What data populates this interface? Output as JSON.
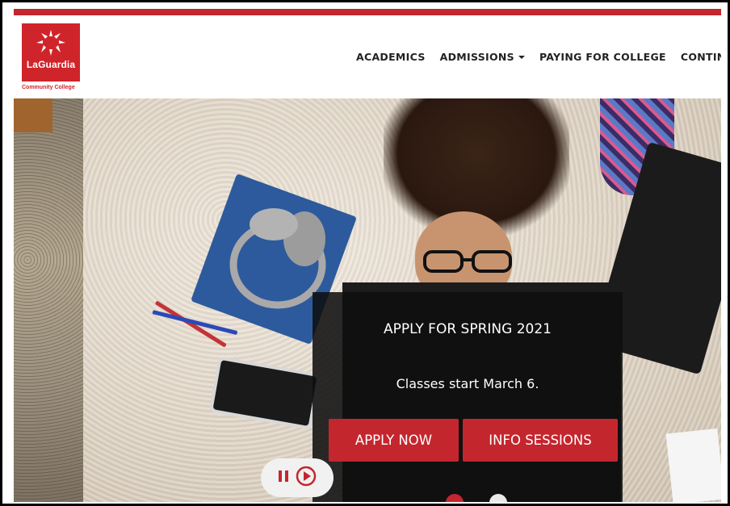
{
  "brand": {
    "name": "LaGuardia",
    "subtitle": "Community College",
    "color": "#d0242b"
  },
  "nav": {
    "items": [
      {
        "label": "ACADEMICS"
      },
      {
        "label": "ADMISSIONS"
      },
      {
        "label": "PAYING FOR COLLEGE"
      },
      {
        "label": "CONTINUING"
      }
    ]
  },
  "hero": {
    "title": "APPLY FOR SPRING 2021",
    "subtitle": "Classes start March 6.",
    "primary_button": "APPLY NOW",
    "secondary_button": "INFO SESSIONS",
    "accent_color": "#c4262e"
  },
  "slider": {
    "pause_icon": "pause-icon",
    "play_icon": "play-icon",
    "active_slide": 1,
    "slide_count": 2
  }
}
